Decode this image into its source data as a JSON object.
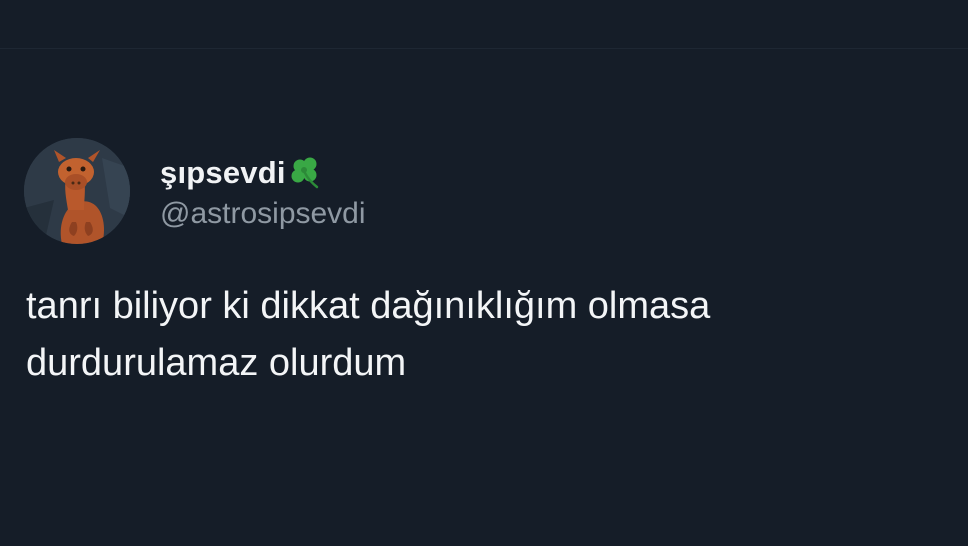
{
  "tweet": {
    "author": {
      "display_name": "şıpsevdi",
      "emoji_icon": "four-leaf-clover-icon",
      "handle": "@astrosipsevdi",
      "avatar": "camel-avatar"
    },
    "text_lines": [
      "tanrı biliyor ki dikkat dağınıklığım olmasa",
      "durdurulamaz olurdum"
    ]
  },
  "theme": {
    "background": "#151d28",
    "text_primary": "#f3f5f7",
    "text_secondary": "#8f99a3",
    "clover_green": "#39a845"
  }
}
